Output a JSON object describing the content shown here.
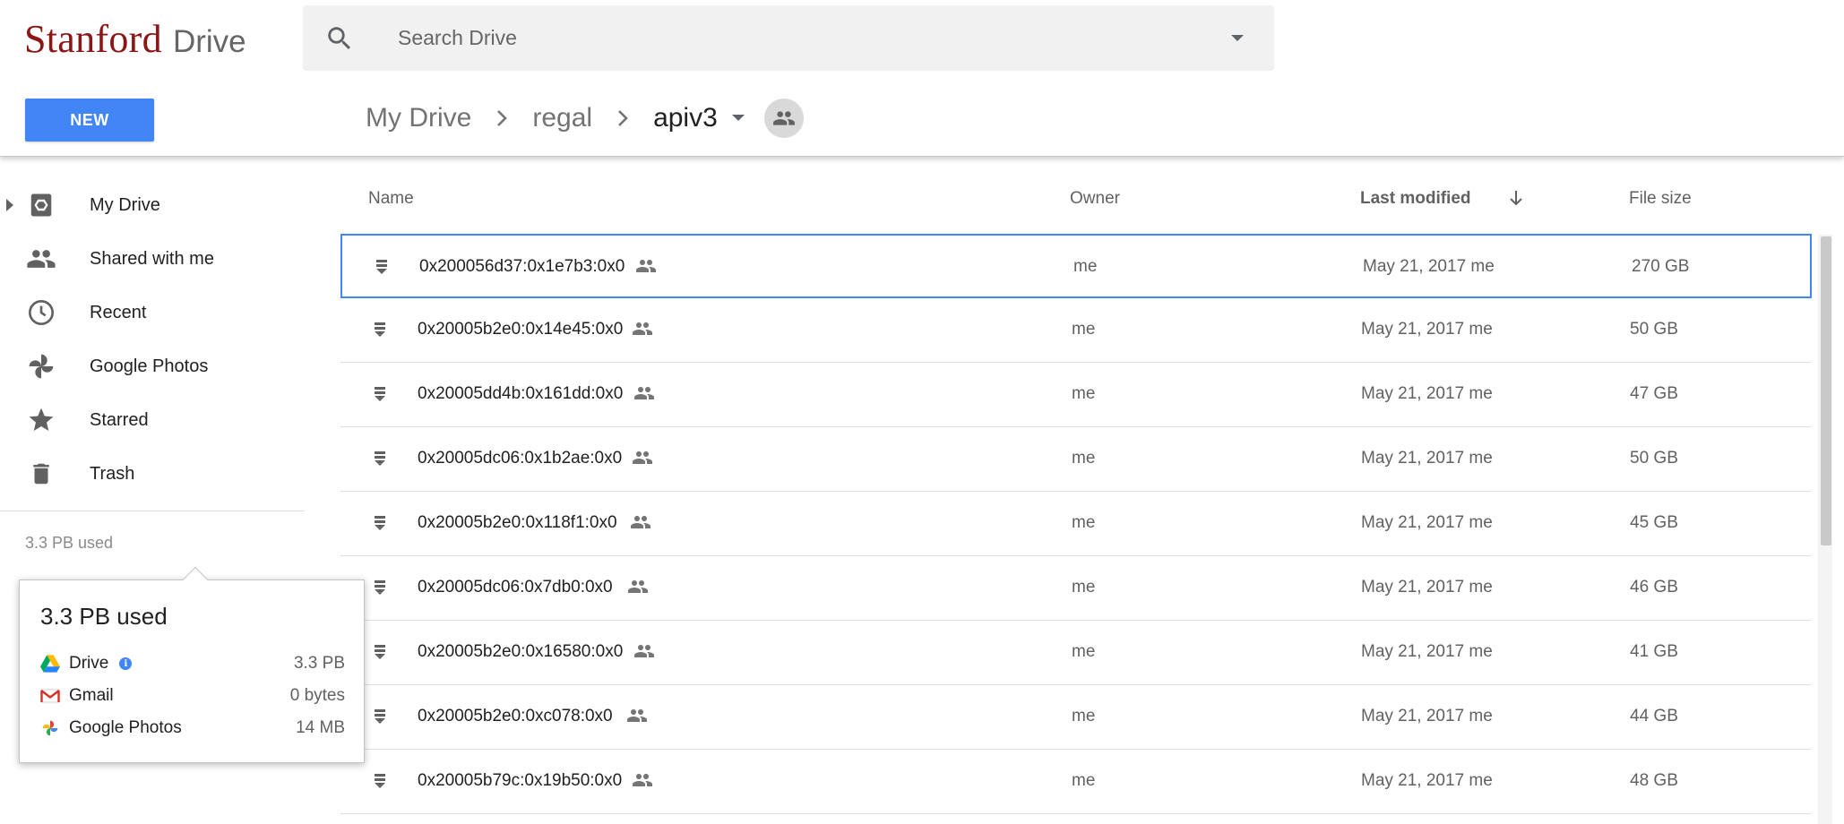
{
  "logo": {
    "brand": "Stanford",
    "product": "Drive"
  },
  "search": {
    "placeholder": "Search Drive",
    "value": ""
  },
  "new_button": {
    "label": "NEW"
  },
  "breadcrumb": {
    "items": [
      "My Drive",
      "regal",
      "apiv3"
    ]
  },
  "sidebar": {
    "items": [
      {
        "label": "My Drive",
        "icon": "drive-icon"
      },
      {
        "label": "Shared with me",
        "icon": "people-icon"
      },
      {
        "label": "Recent",
        "icon": "clock-icon"
      },
      {
        "label": "Google Photos",
        "icon": "pinwheel-icon"
      },
      {
        "label": "Starred",
        "icon": "star-icon"
      },
      {
        "label": "Trash",
        "icon": "trash-icon"
      }
    ],
    "usage": "3.3 PB used"
  },
  "storage_popup": {
    "title": "3.3 PB used",
    "rows": [
      {
        "label": "Drive",
        "value": "3.3 PB"
      },
      {
        "label": "Gmail",
        "value": "0 bytes"
      },
      {
        "label": "Google Photos",
        "value": "14 MB"
      }
    ]
  },
  "file_list": {
    "columns": {
      "name": "Name",
      "owner": "Owner",
      "modified": "Last modified",
      "size": "File size"
    },
    "rows": [
      {
        "name": "0x200056d37:0x1e7b3:0x0",
        "owner": "me",
        "modified": "May 21, 2017 me",
        "size": "270 GB"
      },
      {
        "name": "0x20005b2e0:0x14e45:0x0",
        "owner": "me",
        "modified": "May 21, 2017 me",
        "size": "50 GB"
      },
      {
        "name": "0x20005dd4b:0x161dd:0x0",
        "owner": "me",
        "modified": "May 21, 2017 me",
        "size": "47 GB"
      },
      {
        "name": "0x20005dc06:0x1b2ae:0x0",
        "owner": "me",
        "modified": "May 21, 2017 me",
        "size": "50 GB"
      },
      {
        "name": "0x20005b2e0:0x118f1:0x0",
        "owner": "me",
        "modified": "May 21, 2017 me",
        "size": "45 GB"
      },
      {
        "name": "0x20005dc06:0x7db0:0x0",
        "owner": "me",
        "modified": "May 21, 2017 me",
        "size": "46 GB"
      },
      {
        "name": "0x20005b2e0:0x16580:0x0",
        "owner": "me",
        "modified": "May 21, 2017 me",
        "size": "41 GB"
      },
      {
        "name": "0x20005b2e0:0xc078:0x0",
        "owner": "me",
        "modified": "May 21, 2017 me",
        "size": "44 GB"
      },
      {
        "name": "0x20005b79c:0x19b50:0x0",
        "owner": "me",
        "modified": "May 21, 2017 me",
        "size": "48 GB"
      }
    ]
  },
  "colors": {
    "brand": "#8c1515",
    "accent": "#4285f4"
  }
}
